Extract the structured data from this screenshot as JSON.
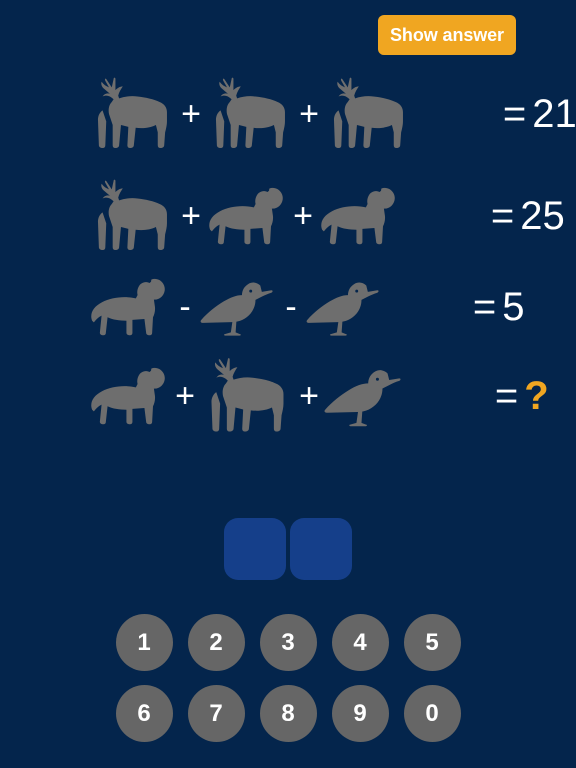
{
  "colors": {
    "background": "#04254c",
    "silhouette": "#6e6e6e",
    "accent": "#f0a621",
    "answer_box": "#153f8a",
    "key": "#666666",
    "text": "#ffffff"
  },
  "toolbar": {
    "show_answer_label": "Show answer"
  },
  "puzzle": {
    "rows": [
      {
        "id": "row-1",
        "terms": [
          "deer",
          "deer",
          "deer"
        ],
        "operators": [
          "+",
          "+"
        ],
        "equals": "=",
        "value": "21"
      },
      {
        "id": "row-2",
        "terms": [
          "deer",
          "dog",
          "dog"
        ],
        "operators": [
          "+",
          "+"
        ],
        "equals": "=",
        "value": "25"
      },
      {
        "id": "row-3",
        "terms": [
          "dog",
          "bird",
          "bird"
        ],
        "operators": [
          "-",
          "-"
        ],
        "equals": "=",
        "value": "5"
      },
      {
        "id": "row-4",
        "terms": [
          "dog",
          "deer",
          "bird"
        ],
        "operators": [
          "+",
          "+"
        ],
        "equals": "=",
        "value": "?"
      }
    ]
  },
  "answer": {
    "digits": [
      "",
      ""
    ]
  },
  "keypad": {
    "row1": [
      "1",
      "2",
      "3",
      "4",
      "5"
    ],
    "row2": [
      "6",
      "7",
      "8",
      "9",
      "0"
    ]
  }
}
